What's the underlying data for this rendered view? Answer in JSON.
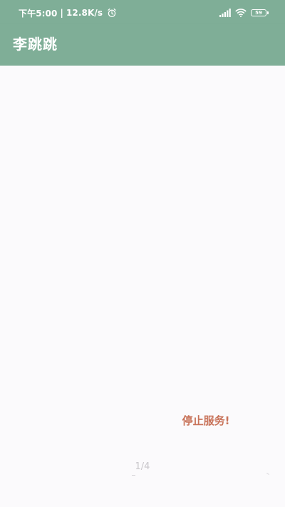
{
  "status_bar": {
    "time": "下午5:00",
    "separator": "|",
    "network_speed": "12.8K/s",
    "alarm_icon": "alarm-clock-icon",
    "signal_icon": "cellular-signal-icon",
    "wifi_icon": "wifi-icon",
    "battery_level": "59"
  },
  "app_bar": {
    "title": "李跳跳",
    "background_color": "#7fae97"
  },
  "main": {
    "stop_service_label": "停止服务!",
    "stop_service_color": "#c8735a",
    "page_indicator": "1/4"
  }
}
